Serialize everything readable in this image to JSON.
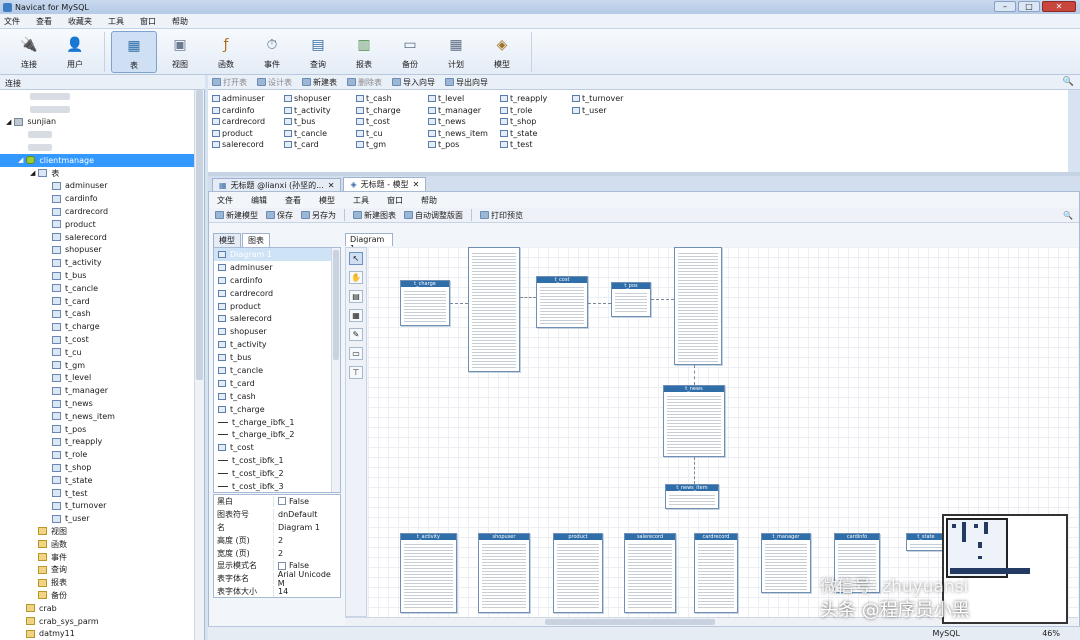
{
  "window": {
    "title": "Navicat for MySQL"
  },
  "menu": [
    "文件",
    "查看",
    "收藏夹",
    "工具",
    "窗口",
    "帮助"
  ],
  "toolbar": [
    {
      "label": "连接",
      "icon": "plug-icon"
    },
    {
      "label": "用户",
      "icon": "user-icon"
    },
    {
      "label": "表",
      "icon": "table-icon",
      "active": true
    },
    {
      "label": "视图",
      "icon": "view-icon"
    },
    {
      "label": "函数",
      "icon": "function-icon"
    },
    {
      "label": "事件",
      "icon": "clock-icon"
    },
    {
      "label": "查询",
      "icon": "query-icon"
    },
    {
      "label": "报表",
      "icon": "report-icon"
    },
    {
      "label": "备份",
      "icon": "backup-icon"
    },
    {
      "label": "计划",
      "icon": "calendar-icon"
    },
    {
      "label": "模型",
      "icon": "model-icon"
    }
  ],
  "connbar": {
    "label": "连接"
  },
  "objtoolbar": [
    {
      "label": "打开表",
      "enabled": false
    },
    {
      "label": "设计表",
      "enabled": false
    },
    {
      "label": "新建表",
      "enabled": true
    },
    {
      "label": "删除表",
      "enabled": false
    },
    {
      "label": "导入向导",
      "enabled": true
    },
    {
      "label": "导出向导",
      "enabled": true
    }
  ],
  "tree": {
    "server": "sunjian",
    "database": "clientmanage",
    "tables_label": "表",
    "tables": [
      "adminuser",
      "cardinfo",
      "cardrecord",
      "product",
      "salerecord",
      "shopuser",
      "t_activity",
      "t_bus",
      "t_cancle",
      "t_card",
      "t_cash",
      "t_charge",
      "t_cost",
      "t_cu",
      "t_gm",
      "t_level",
      "t_manager",
      "t_news",
      "t_news_item",
      "t_pos",
      "t_reapply",
      "t_role",
      "t_shop",
      "t_state",
      "t_test",
      "t_turnover",
      "t_user"
    ],
    "categories": [
      "视图",
      "函数",
      "事件",
      "查询",
      "报表",
      "备份"
    ],
    "other_dbs": [
      "crab",
      "crab_sys_parm",
      "datmy11"
    ]
  },
  "objects": [
    "adminuser",
    "cardinfo",
    "cardrecord",
    "product",
    "salerecord",
    "shopuser",
    "t_activity",
    "t_bus",
    "t_cancle",
    "t_card",
    "t_cash",
    "t_charge",
    "t_cost",
    "t_cu",
    "t_gm",
    "t_level",
    "t_manager",
    "t_news",
    "t_news_item",
    "t_pos",
    "t_reapply",
    "t_role",
    "t_shop",
    "t_state",
    "t_test",
    "t_turnover",
    "t_user"
  ],
  "doctabs": [
    {
      "label": "无标题 @lianxi (孙坚的...",
      "active": false
    },
    {
      "label": "无标题 - 模型",
      "active": true
    }
  ],
  "model": {
    "menu": [
      "文件",
      "编辑",
      "查看",
      "模型",
      "工具",
      "窗口",
      "帮助"
    ],
    "tools": [
      "新建模型",
      "保存",
      "另存为",
      "新建图表",
      "自动调整版面",
      "打印预览"
    ],
    "lefttabs": [
      "模型",
      "图表"
    ],
    "diagram_tab": "Diagram 1",
    "list": [
      "Diagram 1",
      "adminuser",
      "cardinfo",
      "cardrecord",
      "product",
      "salerecord",
      "shopuser",
      "t_activity",
      "t_bus",
      "t_cancle",
      "t_card",
      "t_cash",
      "t_charge",
      "t_charge_ibfk_1",
      "t_charge_ibfk_2",
      "t_cost",
      "t_cost_ibfk_1",
      "t_cost_ibfk_2",
      "t_cost_ibfk_3"
    ],
    "props": [
      {
        "k": "黑白",
        "v": "False",
        "check": true
      },
      {
        "k": "图表符号",
        "v": "dnDefault"
      },
      {
        "k": "名",
        "v": "Diagram 1"
      },
      {
        "k": "高度 (页)",
        "v": "2"
      },
      {
        "k": "宽度 (页)",
        "v": "2"
      },
      {
        "k": "显示模式名",
        "v": "False",
        "check": true
      },
      {
        "k": "表字体名",
        "v": "Arial Unicode M"
      },
      {
        "k": "表字体大小",
        "v": "14"
      }
    ],
    "entities": [
      {
        "name": "t_charge"
      },
      {
        "name": ""
      },
      {
        "name": "t_cost"
      },
      {
        "name": "t_pos"
      },
      {
        "name": ""
      },
      {
        "name": "t_news"
      },
      {
        "name": "t_news_item"
      },
      {
        "name": "t_activity"
      },
      {
        "name": "shopuser"
      },
      {
        "name": "product"
      },
      {
        "name": "salerecord"
      },
      {
        "name": "cardrecord"
      },
      {
        "name": "t_manager"
      },
      {
        "name": "cardinfo"
      },
      {
        "name": "t_state"
      }
    ]
  },
  "status": {
    "db": "MySQL",
    "zoom": "46%"
  },
  "watermark": {
    "line1": "微信号: zhuyuansi",
    "line2": "头条 @程序员小黑"
  }
}
